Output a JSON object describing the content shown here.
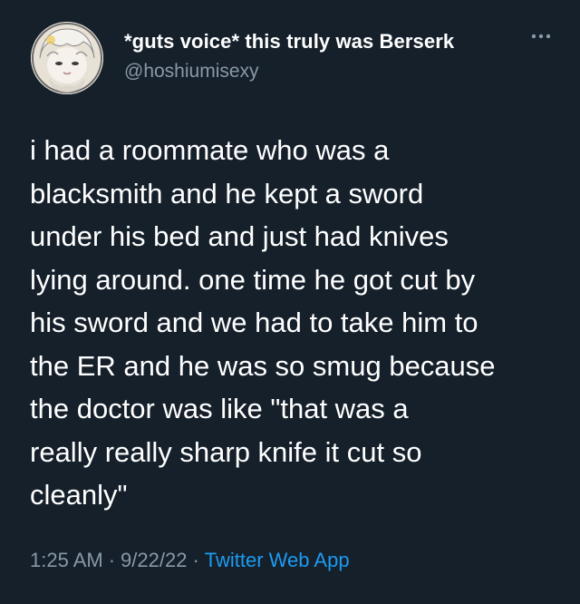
{
  "author": {
    "display_name": "*guts voice* this truly was Berserk",
    "handle": "@hoshiumisexy"
  },
  "more_icon": "more-horizontal-icon",
  "tweet_lines": [
    "i had a roommate who was a",
    "blacksmith and he kept a sword",
    "under his bed and just had knives",
    "lying around. one time he got cut by",
    "his sword and we had to take him to",
    "the ER and he was so smug because",
    "the doctor was like \"that was a",
    "really really sharp knife it cut so",
    "cleanly\""
  ],
  "meta": {
    "time": "1:25 AM",
    "separator": "·",
    "date": "9/22/22",
    "source": "Twitter Web App"
  },
  "colors": {
    "background": "#15202b",
    "text": "#ffffff",
    "secondary": "#8899a6",
    "link": "#1d9bf0"
  }
}
